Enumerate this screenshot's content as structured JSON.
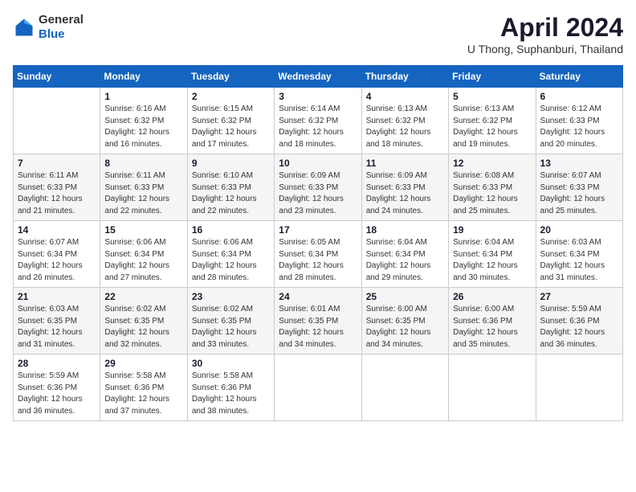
{
  "header": {
    "logo_general": "General",
    "logo_blue": "Blue",
    "month": "April 2024",
    "location": "U Thong, Suphanburi, Thailand"
  },
  "days_of_week": [
    "Sunday",
    "Monday",
    "Tuesday",
    "Wednesday",
    "Thursday",
    "Friday",
    "Saturday"
  ],
  "weeks": [
    [
      {
        "day": "",
        "sunrise": "",
        "sunset": "",
        "daylight": ""
      },
      {
        "day": "1",
        "sunrise": "Sunrise: 6:16 AM",
        "sunset": "Sunset: 6:32 PM",
        "daylight": "Daylight: 12 hours and 16 minutes."
      },
      {
        "day": "2",
        "sunrise": "Sunrise: 6:15 AM",
        "sunset": "Sunset: 6:32 PM",
        "daylight": "Daylight: 12 hours and 17 minutes."
      },
      {
        "day": "3",
        "sunrise": "Sunrise: 6:14 AM",
        "sunset": "Sunset: 6:32 PM",
        "daylight": "Daylight: 12 hours and 18 minutes."
      },
      {
        "day": "4",
        "sunrise": "Sunrise: 6:13 AM",
        "sunset": "Sunset: 6:32 PM",
        "daylight": "Daylight: 12 hours and 18 minutes."
      },
      {
        "day": "5",
        "sunrise": "Sunrise: 6:13 AM",
        "sunset": "Sunset: 6:32 PM",
        "daylight": "Daylight: 12 hours and 19 minutes."
      },
      {
        "day": "6",
        "sunrise": "Sunrise: 6:12 AM",
        "sunset": "Sunset: 6:33 PM",
        "daylight": "Daylight: 12 hours and 20 minutes."
      }
    ],
    [
      {
        "day": "7",
        "sunrise": "Sunrise: 6:11 AM",
        "sunset": "Sunset: 6:33 PM",
        "daylight": "Daylight: 12 hours and 21 minutes."
      },
      {
        "day": "8",
        "sunrise": "Sunrise: 6:11 AM",
        "sunset": "Sunset: 6:33 PM",
        "daylight": "Daylight: 12 hours and 22 minutes."
      },
      {
        "day": "9",
        "sunrise": "Sunrise: 6:10 AM",
        "sunset": "Sunset: 6:33 PM",
        "daylight": "Daylight: 12 hours and 22 minutes."
      },
      {
        "day": "10",
        "sunrise": "Sunrise: 6:09 AM",
        "sunset": "Sunset: 6:33 PM",
        "daylight": "Daylight: 12 hours and 23 minutes."
      },
      {
        "day": "11",
        "sunrise": "Sunrise: 6:09 AM",
        "sunset": "Sunset: 6:33 PM",
        "daylight": "Daylight: 12 hours and 24 minutes."
      },
      {
        "day": "12",
        "sunrise": "Sunrise: 6:08 AM",
        "sunset": "Sunset: 6:33 PM",
        "daylight": "Daylight: 12 hours and 25 minutes."
      },
      {
        "day": "13",
        "sunrise": "Sunrise: 6:07 AM",
        "sunset": "Sunset: 6:33 PM",
        "daylight": "Daylight: 12 hours and 25 minutes."
      }
    ],
    [
      {
        "day": "14",
        "sunrise": "Sunrise: 6:07 AM",
        "sunset": "Sunset: 6:34 PM",
        "daylight": "Daylight: 12 hours and 26 minutes."
      },
      {
        "day": "15",
        "sunrise": "Sunrise: 6:06 AM",
        "sunset": "Sunset: 6:34 PM",
        "daylight": "Daylight: 12 hours and 27 minutes."
      },
      {
        "day": "16",
        "sunrise": "Sunrise: 6:06 AM",
        "sunset": "Sunset: 6:34 PM",
        "daylight": "Daylight: 12 hours and 28 minutes."
      },
      {
        "day": "17",
        "sunrise": "Sunrise: 6:05 AM",
        "sunset": "Sunset: 6:34 PM",
        "daylight": "Daylight: 12 hours and 28 minutes."
      },
      {
        "day": "18",
        "sunrise": "Sunrise: 6:04 AM",
        "sunset": "Sunset: 6:34 PM",
        "daylight": "Daylight: 12 hours and 29 minutes."
      },
      {
        "day": "19",
        "sunrise": "Sunrise: 6:04 AM",
        "sunset": "Sunset: 6:34 PM",
        "daylight": "Daylight: 12 hours and 30 minutes."
      },
      {
        "day": "20",
        "sunrise": "Sunrise: 6:03 AM",
        "sunset": "Sunset: 6:34 PM",
        "daylight": "Daylight: 12 hours and 31 minutes."
      }
    ],
    [
      {
        "day": "21",
        "sunrise": "Sunrise: 6:03 AM",
        "sunset": "Sunset: 6:35 PM",
        "daylight": "Daylight: 12 hours and 31 minutes."
      },
      {
        "day": "22",
        "sunrise": "Sunrise: 6:02 AM",
        "sunset": "Sunset: 6:35 PM",
        "daylight": "Daylight: 12 hours and 32 minutes."
      },
      {
        "day": "23",
        "sunrise": "Sunrise: 6:02 AM",
        "sunset": "Sunset: 6:35 PM",
        "daylight": "Daylight: 12 hours and 33 minutes."
      },
      {
        "day": "24",
        "sunrise": "Sunrise: 6:01 AM",
        "sunset": "Sunset: 6:35 PM",
        "daylight": "Daylight: 12 hours and 34 minutes."
      },
      {
        "day": "25",
        "sunrise": "Sunrise: 6:00 AM",
        "sunset": "Sunset: 6:35 PM",
        "daylight": "Daylight: 12 hours and 34 minutes."
      },
      {
        "day": "26",
        "sunrise": "Sunrise: 6:00 AM",
        "sunset": "Sunset: 6:36 PM",
        "daylight": "Daylight: 12 hours and 35 minutes."
      },
      {
        "day": "27",
        "sunrise": "Sunrise: 5:59 AM",
        "sunset": "Sunset: 6:36 PM",
        "daylight": "Daylight: 12 hours and 36 minutes."
      }
    ],
    [
      {
        "day": "28",
        "sunrise": "Sunrise: 5:59 AM",
        "sunset": "Sunset: 6:36 PM",
        "daylight": "Daylight: 12 hours and 36 minutes."
      },
      {
        "day": "29",
        "sunrise": "Sunrise: 5:58 AM",
        "sunset": "Sunset: 6:36 PM",
        "daylight": "Daylight: 12 hours and 37 minutes."
      },
      {
        "day": "30",
        "sunrise": "Sunrise: 5:58 AM",
        "sunset": "Sunset: 6:36 PM",
        "daylight": "Daylight: 12 hours and 38 minutes."
      },
      {
        "day": "",
        "sunrise": "",
        "sunset": "",
        "daylight": ""
      },
      {
        "day": "",
        "sunrise": "",
        "sunset": "",
        "daylight": ""
      },
      {
        "day": "",
        "sunrise": "",
        "sunset": "",
        "daylight": ""
      },
      {
        "day": "",
        "sunrise": "",
        "sunset": "",
        "daylight": ""
      }
    ]
  ]
}
